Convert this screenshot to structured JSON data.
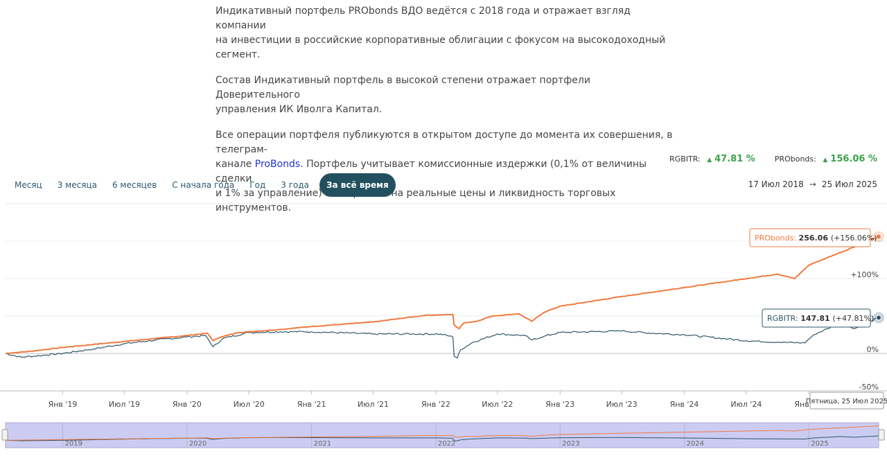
{
  "intro": {
    "p1": [
      "Индикативный портфель PRObonds ВДО ведётся с 2018 года и отражает взгляд компании",
      "на инвестиции в российские корпоративные облигации с фокусом на высокодоходный сегмент."
    ],
    "p2": [
      "Состав Индикативный портфель в высокой степени отражает портфели Доверительного",
      "управления ИК Иволга Капитал."
    ],
    "p3_line1": "Все операции портфеля публикуются в открытом доступе до момента их совершения, в телеграм-",
    "p3_line2_before": "канале ",
    "p3_link": "ProBonds",
    "p3_line2_after": ". Портфель учитывает комиссионные издержки (0,1% от величины сделки",
    "p3_line3": "и 1% за управление) и опирается на реальные цены и ликвидность торговых инструментов."
  },
  "summary": {
    "rgbitr_label": "RGBITR:",
    "rgbitr_value": "47.81 %",
    "probonds_label": "PRObonds:",
    "probonds_value": "156.06 %",
    "up_symbol": "▲"
  },
  "range_buttons": [
    "Месяц",
    "3 месяца",
    "6 месяцев",
    "С начала года",
    "Год",
    "3 года",
    "За всё время"
  ],
  "active_range": "За всё время",
  "date_range": {
    "from": "17 Июл 2018",
    "arrow": "→",
    "to": "25 Июл 2025"
  },
  "colors": {
    "probonds": "#f07a3e",
    "rgbitr": "#2e5566",
    "accent_active": "#23505e",
    "positive": "#3aa24c",
    "link": "#1d33d8",
    "navigator_bg": "#ccccf2"
  },
  "chart_data": {
    "type": "line",
    "x_start": "2018-07-17",
    "x_end": "2025-07-25",
    "y_unit": "%",
    "ylim": [
      -50,
      160
    ],
    "y_ticks": [
      "-50%",
      "0%",
      "+100%"
    ],
    "x_ticks": [
      "Янв '19",
      "Июл '19",
      "Янв '20",
      "Июл '20",
      "Янв '21",
      "Июл '21",
      "Янв '22",
      "Июл '22",
      "Янв '23",
      "Июл '23",
      "Янв '24",
      "Июл '24",
      "Янв '25"
    ],
    "navigator_years": [
      "2019",
      "2020",
      "2021",
      "2022",
      "2023",
      "2024",
      "2025"
    ],
    "series": [
      {
        "name": "PRObonds",
        "points": [
          [
            "2018-07-17",
            0
          ],
          [
            "2018-10-01",
            3
          ],
          [
            "2019-01-01",
            8
          ],
          [
            "2019-04-01",
            12
          ],
          [
            "2019-07-01",
            16
          ],
          [
            "2019-10-01",
            20
          ],
          [
            "2020-01-01",
            24
          ],
          [
            "2020-03-01",
            27
          ],
          [
            "2020-03-18",
            17
          ],
          [
            "2020-04-10",
            22
          ],
          [
            "2020-06-01",
            28
          ],
          [
            "2020-10-01",
            32
          ],
          [
            "2021-01-01",
            36
          ],
          [
            "2021-07-01",
            42
          ],
          [
            "2021-12-01",
            51
          ],
          [
            "2022-02-20",
            52
          ],
          [
            "2022-02-24",
            38
          ],
          [
            "2022-03-10",
            33
          ],
          [
            "2022-03-25",
            41
          ],
          [
            "2022-05-01",
            43
          ],
          [
            "2022-06-15",
            50
          ],
          [
            "2022-09-01",
            53
          ],
          [
            "2022-10-10",
            43
          ],
          [
            "2022-11-15",
            55
          ],
          [
            "2023-01-01",
            63
          ],
          [
            "2023-07-01",
            76
          ],
          [
            "2024-01-01",
            88
          ],
          [
            "2024-07-01",
            100
          ],
          [
            "2024-10-01",
            106
          ],
          [
            "2024-11-20",
            100
          ],
          [
            "2025-01-01",
            118
          ],
          [
            "2025-05-01",
            140
          ],
          [
            "2025-07-25",
            156.06
          ]
        ]
      },
      {
        "name": "RGBITR",
        "points": [
          [
            "2018-07-17",
            0
          ],
          [
            "2018-09-01",
            -5
          ],
          [
            "2018-11-15",
            -2
          ],
          [
            "2019-01-01",
            0
          ],
          [
            "2019-04-01",
            6
          ],
          [
            "2019-07-01",
            13
          ],
          [
            "2019-10-01",
            18
          ],
          [
            "2020-01-01",
            22
          ],
          [
            "2020-02-25",
            24
          ],
          [
            "2020-03-18",
            9
          ],
          [
            "2020-04-15",
            20
          ],
          [
            "2020-07-01",
            28
          ],
          [
            "2020-10-01",
            29
          ],
          [
            "2021-01-01",
            29
          ],
          [
            "2021-07-01",
            26
          ],
          [
            "2021-10-01",
            26
          ],
          [
            "2022-01-15",
            26
          ],
          [
            "2022-02-20",
            22
          ],
          [
            "2022-02-24",
            -4
          ],
          [
            "2022-03-05",
            -6
          ],
          [
            "2022-03-15",
            5
          ],
          [
            "2022-04-20",
            15
          ],
          [
            "2022-07-01",
            26
          ],
          [
            "2022-09-20",
            24
          ],
          [
            "2022-10-10",
            18
          ],
          [
            "2022-11-15",
            23
          ],
          [
            "2023-01-01",
            28
          ],
          [
            "2023-07-01",
            30
          ],
          [
            "2023-10-01",
            27
          ],
          [
            "2024-01-01",
            25
          ],
          [
            "2024-07-01",
            17
          ],
          [
            "2024-10-01",
            15
          ],
          [
            "2024-12-20",
            14
          ],
          [
            "2025-01-15",
            25
          ],
          [
            "2025-04-01",
            40
          ],
          [
            "2025-05-15",
            33
          ],
          [
            "2025-07-25",
            47.81
          ]
        ]
      }
    ],
    "tooltips": {
      "probonds": {
        "name": "PRObonds",
        "value": "256.06",
        "change": "(+156.06%)"
      },
      "rgbitr": {
        "name": "RGBITR",
        "value": "147.81",
        "change": "(+47.81%)"
      },
      "date": "Пятница, 25 Июл 2025"
    }
  }
}
